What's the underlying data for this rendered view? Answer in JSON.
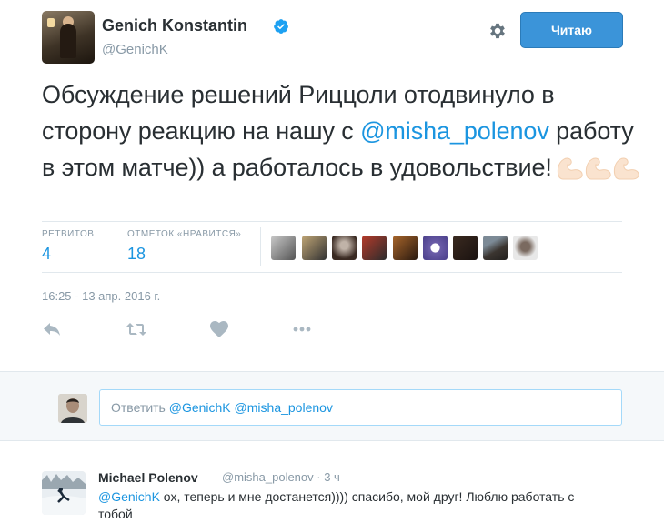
{
  "tweet": {
    "author_name": "Genich Konstantin",
    "author_handle": "@GenichK",
    "follow_label": "Читаю",
    "text_part1": "Обсуждение решений Риццоли отодвинуло в сторону реакцию на нашу с ",
    "mention": "@misha_polenov",
    "text_part2": " работу в этом матче)) а работалось в удовольствие!",
    "emoji": "flexed-biceps-x3",
    "retweets_label": "РЕТВИТОВ",
    "retweets_count": "4",
    "likes_label": "ОТМЕТОК «НРАВИТСЯ»",
    "likes_count": "18",
    "timestamp": "16:25 - 13 апр. 2016 г.",
    "accent_color": "#1b95e0",
    "liker_avatars": 10
  },
  "actions": [
    "reply-icon",
    "retweet-icon",
    "heart-icon",
    "more-icon"
  ],
  "reply_box": {
    "prefix": "Ответить",
    "mention1": "@GenichK",
    "mention2": "@misha_polenov"
  },
  "reply_tweet": {
    "author_name": "Michael Polenov",
    "author_handle": "@misha_polenov",
    "time": "3 ч",
    "mention": "@GenichK",
    "text": " ох, теперь и мне достанется)))) спасибо, мой друг! Люблю работать с тобой"
  }
}
